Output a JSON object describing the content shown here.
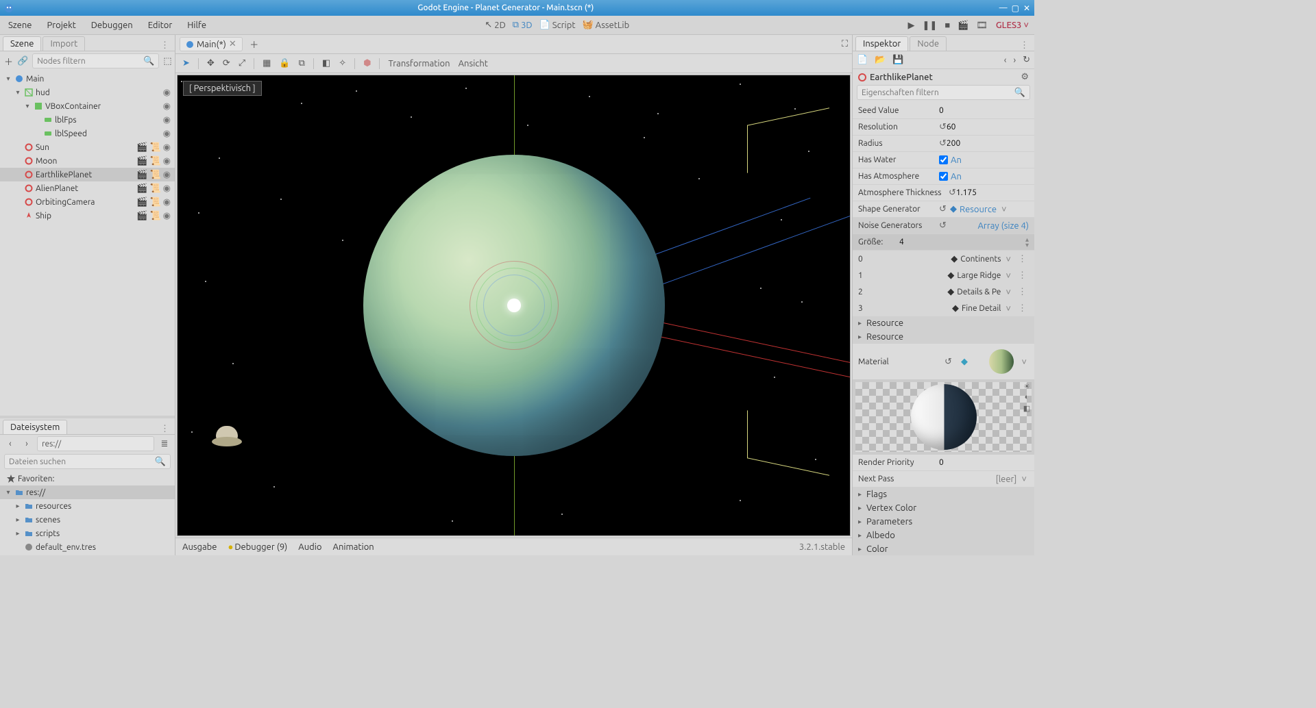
{
  "window": {
    "title": "Godot Engine - Planet Generator - Main.tscn (*)"
  },
  "menubar": {
    "items": [
      "Szene",
      "Projekt",
      "Debuggen",
      "Editor",
      "Hilfe"
    ],
    "center": {
      "2d": "2D",
      "3d": "3D",
      "script": "Script",
      "assetlib": "AssetLib"
    },
    "gles": "GLES3"
  },
  "left": {
    "tabs": {
      "scene": "Szene",
      "import": "Import"
    },
    "filter_placeholder": "Nodes filtern",
    "tree": [
      {
        "name": "Main",
        "depth": 0,
        "kind": "scene",
        "toggle": "▾"
      },
      {
        "name": "hud",
        "depth": 1,
        "kind": "canvas",
        "toggle": "▾",
        "badges": [
          "eye"
        ]
      },
      {
        "name": "VBoxContainer",
        "depth": 2,
        "kind": "control",
        "toggle": "▾",
        "badges": [
          "eye"
        ]
      },
      {
        "name": "lblFps",
        "depth": 3,
        "kind": "label",
        "badges": [
          "eye"
        ]
      },
      {
        "name": "lblSpeed",
        "depth": 3,
        "kind": "label",
        "badges": [
          "eye"
        ]
      },
      {
        "name": "Sun",
        "depth": 1,
        "kind": "spatial",
        "badges": [
          "scene",
          "script",
          "eye"
        ]
      },
      {
        "name": "Moon",
        "depth": 1,
        "kind": "spatial",
        "badges": [
          "scene",
          "script",
          "eye"
        ]
      },
      {
        "name": "EarthlikePlanet",
        "depth": 1,
        "kind": "spatial",
        "badges": [
          "scene",
          "script",
          "eye"
        ],
        "selected": true
      },
      {
        "name": "AlienPlanet",
        "depth": 1,
        "kind": "spatial",
        "badges": [
          "scene",
          "script",
          "eye"
        ]
      },
      {
        "name": "OrbitingCamera",
        "depth": 1,
        "kind": "spatial",
        "badges": [
          "scene",
          "script",
          "eye"
        ]
      },
      {
        "name": "Ship",
        "depth": 1,
        "kind": "ship",
        "badges": [
          "scene",
          "script",
          "eye"
        ]
      }
    ],
    "fs_tab": "Dateisystem",
    "fs_path": "res://",
    "fs_filter_placeholder": "Dateien suchen",
    "fs_fav": "Favoriten:",
    "fs_tree": [
      {
        "name": "res://",
        "depth": 0,
        "kind": "folder",
        "toggle": "▾",
        "selected": true
      },
      {
        "name": "resources",
        "depth": 1,
        "kind": "folder",
        "toggle": "▸"
      },
      {
        "name": "scenes",
        "depth": 1,
        "kind": "folder",
        "toggle": "▸"
      },
      {
        "name": "scripts",
        "depth": 1,
        "kind": "folder",
        "toggle": "▸"
      },
      {
        "name": "default_env.tres",
        "depth": 1,
        "kind": "resource"
      }
    ]
  },
  "center": {
    "scene_tab": "Main(*)",
    "vtoolbar": {
      "transformation": "Transformation",
      "view": "Ansicht"
    },
    "perspective": "Perspektivisch"
  },
  "bottombar": {
    "output": "Ausgabe",
    "debugger": "Debugger (9)",
    "audio": "Audio",
    "animation": "Animation",
    "version": "3.2.1.stable"
  },
  "right": {
    "tabs": {
      "inspector": "Inspektor",
      "node": "Node"
    },
    "node_name": "EarthlikePlanet",
    "filter_placeholder": "Eigenschaften filtern",
    "props": {
      "seed": {
        "label": "Seed Value",
        "value": "0"
      },
      "resolution": {
        "label": "Resolution",
        "value": "60"
      },
      "radius": {
        "label": "Radius",
        "value": "200"
      },
      "has_water": {
        "label": "Has Water",
        "value": "An"
      },
      "has_atmo": {
        "label": "Has Atmosphere",
        "value": "An"
      },
      "atmo_thick": {
        "label": "Atmosphere Thickness",
        "value": "1.175"
      },
      "shape_gen": {
        "label": "Shape Generator",
        "value": "Resource"
      },
      "noise_gen": {
        "label": "Noise Generators",
        "value": "Array (size 4)"
      },
      "size_label": "Größe:",
      "size_value": "4",
      "items": [
        {
          "idx": "0",
          "name": "Continents"
        },
        {
          "idx": "1",
          "name": "Large Ridge"
        },
        {
          "idx": "2",
          "name": "Details & Pe"
        },
        {
          "idx": "3",
          "name": "Fine Detail"
        }
      ],
      "resource_sub1": "Resource",
      "resource_sub2": "Resource",
      "material": {
        "label": "Material"
      },
      "render_priority": {
        "label": "Render Priority",
        "value": "0"
      },
      "next_pass": {
        "label": "Next Pass",
        "value": "[leer]"
      },
      "sections": [
        "Flags",
        "Vertex Color",
        "Parameters",
        "Albedo",
        "Color"
      ]
    }
  }
}
